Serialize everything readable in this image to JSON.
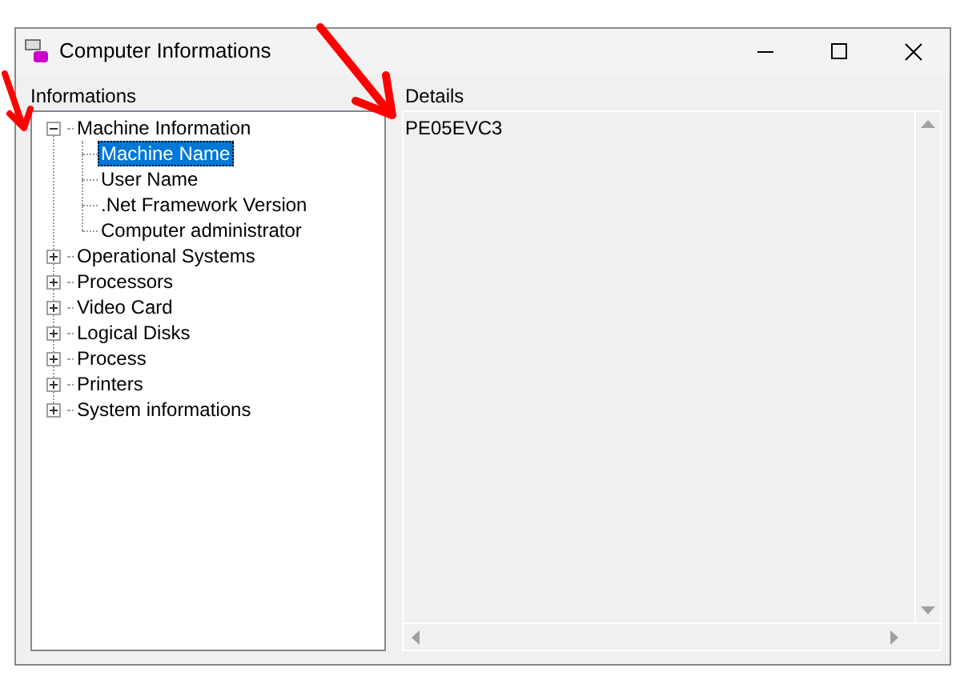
{
  "window": {
    "title": "Computer Informations"
  },
  "informations": {
    "label": "Informations",
    "tree": [
      {
        "label": "Machine Information",
        "expanded": true,
        "selected": false,
        "children": [
          {
            "label": "Machine Name",
            "selected": true
          },
          {
            "label": "User Name",
            "selected": false
          },
          {
            "label": ".Net Framework Version",
            "selected": false
          },
          {
            "label": "Computer administrator",
            "selected": false
          }
        ]
      },
      {
        "label": "Operational Systems",
        "expanded": false,
        "selected": false
      },
      {
        "label": "Processors",
        "expanded": false,
        "selected": false
      },
      {
        "label": "Video Card",
        "expanded": false,
        "selected": false
      },
      {
        "label": "Logical Disks",
        "expanded": false,
        "selected": false
      },
      {
        "label": "Process",
        "expanded": false,
        "selected": false
      },
      {
        "label": "Printers",
        "expanded": false,
        "selected": false
      },
      {
        "label": "System informations",
        "expanded": false,
        "selected": false
      }
    ]
  },
  "details": {
    "label": "Details",
    "value": "PE05EVC3"
  }
}
